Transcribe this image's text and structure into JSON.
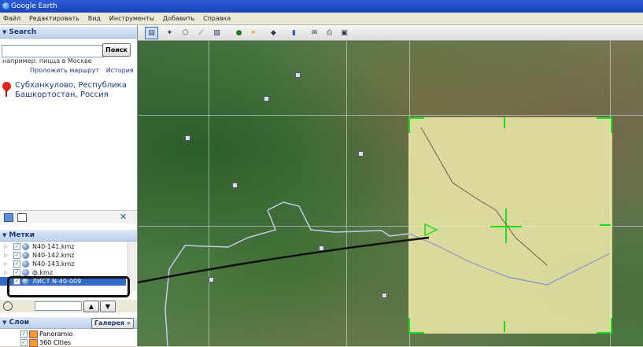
{
  "window": {
    "title": "Google Earth"
  },
  "menu": [
    "Файл",
    "Редактировать",
    "Вид",
    "Инструменты",
    "Добавить",
    "Справка"
  ],
  "search": {
    "header": "Search",
    "input_value": "",
    "button": "Поиск",
    "hint": "например: пицца в Москве",
    "links": [
      "Проложить маршрут",
      "История"
    ],
    "result": "Субханкулово, Республика Башкортостан, Россия"
  },
  "places": {
    "header": "Метки",
    "items": [
      {
        "label": "N40-141.kmz",
        "checked": true,
        "selected": false
      },
      {
        "label": "N40-142.kmz",
        "checked": true,
        "selected": false
      },
      {
        "label": "N40-143.kmz",
        "checked": true,
        "selected": false
      },
      {
        "label": "ф.kmz",
        "checked": true,
        "selected": false
      },
      {
        "label": "ЛИСТ N-40-009",
        "checked": true,
        "selected": true
      }
    ]
  },
  "layers": {
    "header": "Слои",
    "gallery_button": "Галерея",
    "items": [
      {
        "label": "Panoramio",
        "checked": true
      },
      {
        "label": "360 Cities",
        "checked": true
      }
    ]
  },
  "toolbar": {
    "icons": [
      "sidebar-toggle-icon",
      "placemark-icon",
      "polygon-icon",
      "path-icon",
      "image-overlay-icon",
      "record-tour-icon",
      "sun-icon",
      "planets-icon",
      "ruler-icon",
      "email-icon",
      "print-icon",
      "save-image-icon"
    ]
  },
  "colors": {
    "panel_header": "#bcd0ec",
    "selection": "#3169c6",
    "overlay": "#f5f0af",
    "overlay_bracket": "#18e018"
  }
}
